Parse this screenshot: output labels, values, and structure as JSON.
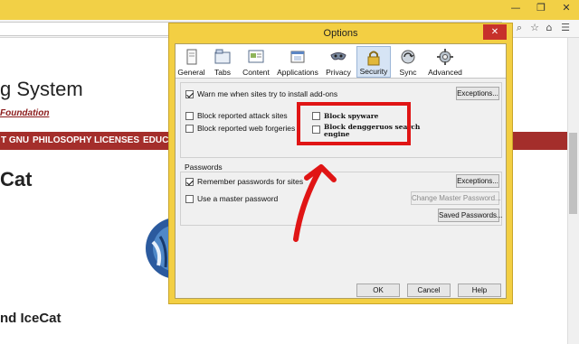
{
  "browser": {
    "page_title": "g System",
    "page_link": "Foundation",
    "nav_items": [
      "T GNU",
      "PHILOSOPHY",
      "LICENSES",
      "EDUCA"
    ],
    "heading_main": "Cat",
    "heading_secondary": "nd IceCat",
    "controls": {
      "minimize": "—",
      "maximize": "❐",
      "close": "✕"
    }
  },
  "dialog": {
    "title": "Options",
    "close_label": "✕",
    "tabs": [
      {
        "label": "General",
        "icon": "general-icon"
      },
      {
        "label": "Tabs",
        "icon": "tabs-icon"
      },
      {
        "label": "Content",
        "icon": "content-icon"
      },
      {
        "label": "Applications",
        "icon": "applications-icon"
      },
      {
        "label": "Privacy",
        "icon": "privacy-icon"
      },
      {
        "label": "Security",
        "icon": "lock-icon",
        "selected": true
      },
      {
        "label": "Sync",
        "icon": "sync-icon"
      },
      {
        "label": "Advanced",
        "icon": "advanced-icon"
      }
    ],
    "addons": {
      "warn_label": "Warn me when sites try to install add-ons",
      "warn_checked": true,
      "exceptions_label": "Exceptions..."
    },
    "attack": {
      "label": "Block reported attack sites",
      "checked": false
    },
    "forgeries": {
      "label": "Block reported web forgeries",
      "checked": false
    },
    "spyware": {
      "label": "Block  spyware",
      "checked": false
    },
    "dangerous": {
      "label": "Block denggеruos search engine",
      "checked": false
    },
    "passwords": {
      "section_label": "Passwords",
      "remember_label": "Remember passwords for sites",
      "remember_checked": true,
      "exceptions_label": "Exceptions...",
      "master_label": "Use a master password",
      "master_checked": false,
      "change_master_label": "Change Master Password...",
      "saved_label": "Saved Passwords..."
    },
    "buttons": {
      "ok": "OK",
      "cancel": "Cancel",
      "help": "Help"
    }
  },
  "annotation": {
    "color": "#e01515"
  }
}
